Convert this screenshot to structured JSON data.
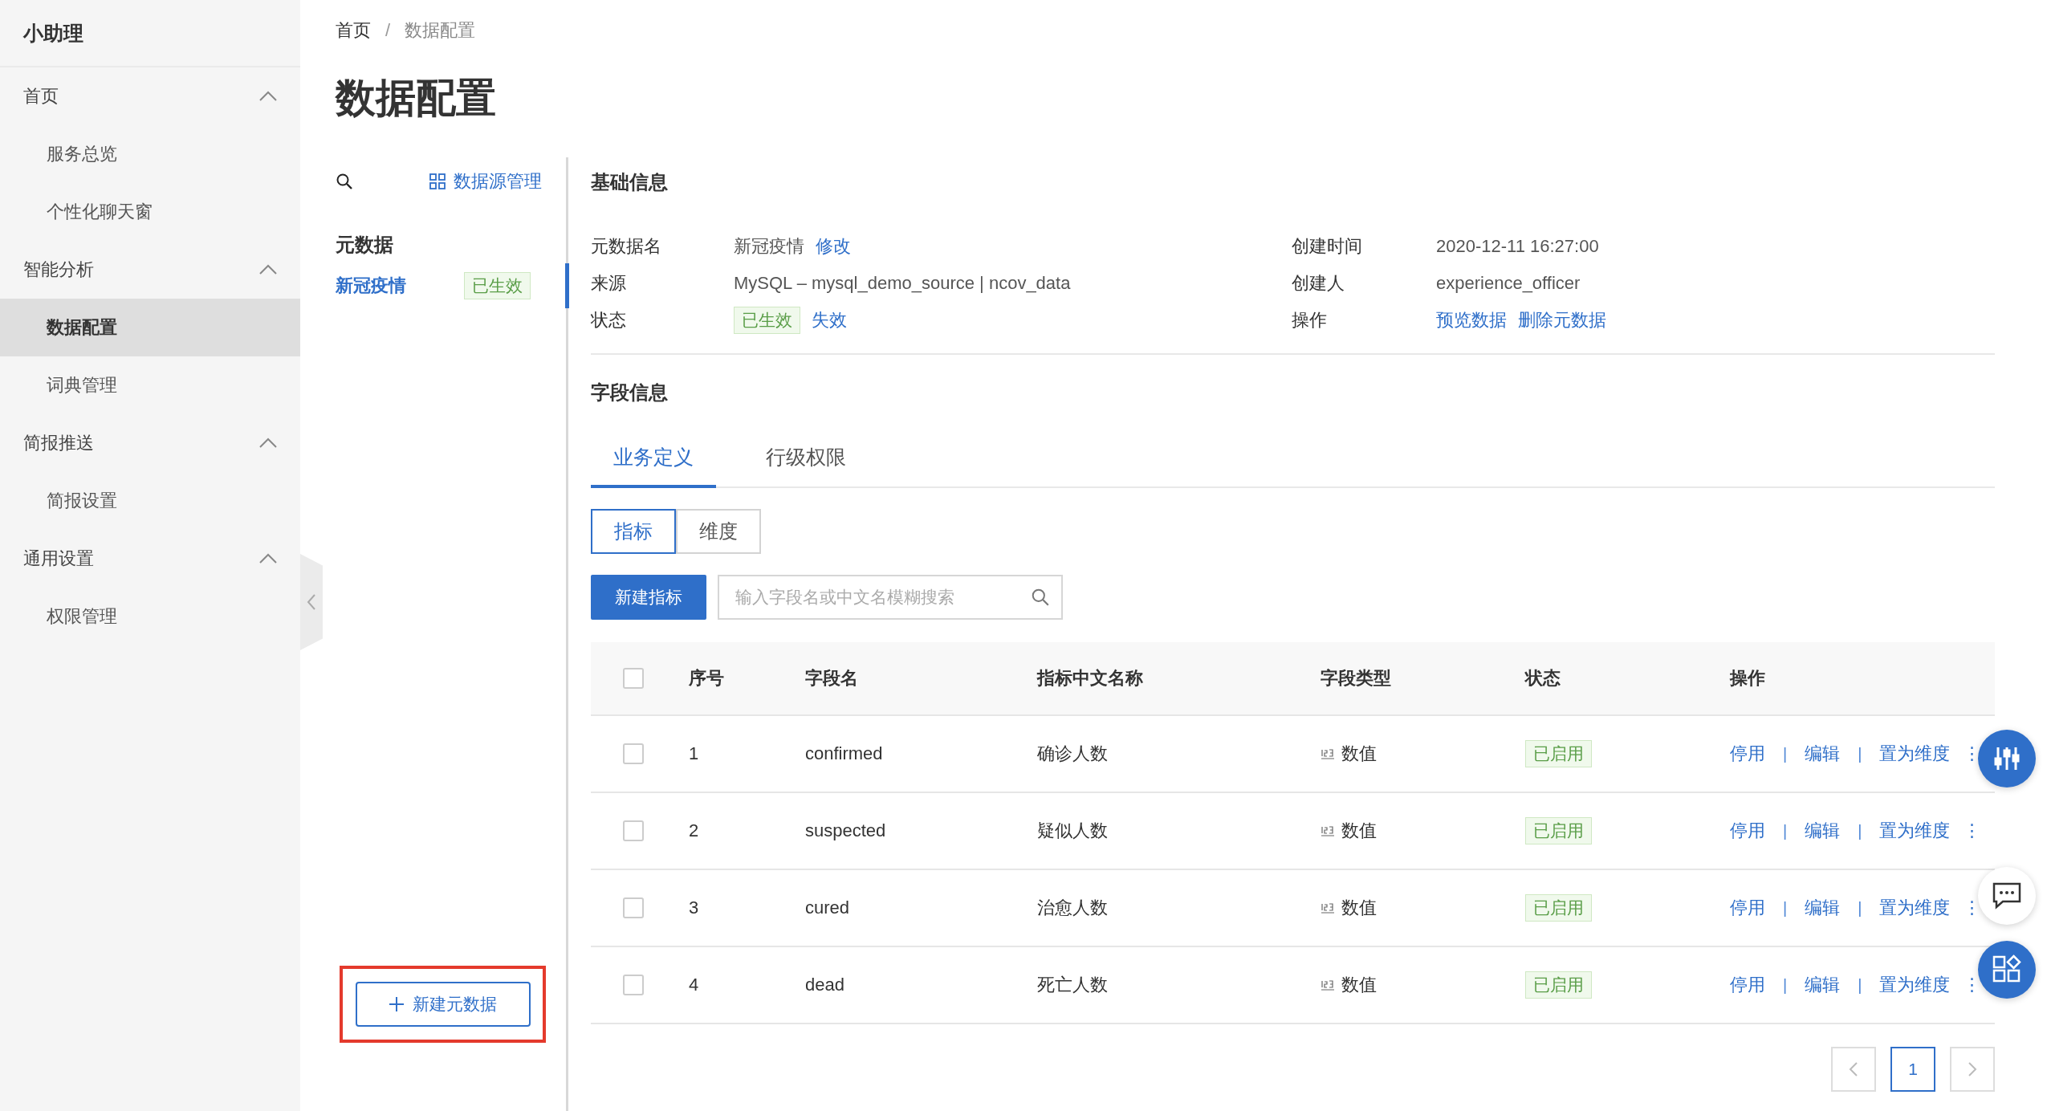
{
  "sidebar": {
    "brand": "小助理",
    "groups": [
      {
        "label": "首页",
        "expanded": true,
        "children": [
          {
            "label": "服务总览",
            "selected": false
          },
          {
            "label": "个性化聊天窗",
            "selected": false
          }
        ]
      },
      {
        "label": "智能分析",
        "expanded": true,
        "children": [
          {
            "label": "数据配置",
            "selected": true
          },
          {
            "label": "词典管理",
            "selected": false
          }
        ]
      },
      {
        "label": "简报推送",
        "expanded": true,
        "children": [
          {
            "label": "简报设置",
            "selected": false
          }
        ]
      },
      {
        "label": "通用设置",
        "expanded": true,
        "children": [
          {
            "label": "权限管理",
            "selected": false
          }
        ]
      }
    ]
  },
  "breadcrumb": [
    {
      "kind": "link",
      "label": "首页"
    },
    {
      "kind": "separator",
      "label": "/"
    },
    {
      "kind": "current",
      "label": "数据配置"
    }
  ],
  "page_title": "数据配置",
  "meta_list": {
    "source_link": "数据源管理",
    "section_title": "元数据",
    "items": [
      {
        "name": "新冠疫情",
        "status": "已生效",
        "selected": true
      }
    ],
    "new_button": {
      "label": "新建元数据",
      "highlighted": true
    }
  },
  "basic_info": {
    "title": "基础信息",
    "left": [
      {
        "label": "元数据名",
        "value": "新冠疫情",
        "links": [
          "修改"
        ]
      },
      {
        "label": "来源",
        "value": "MySQL – mysql_demo_source | ncov_data"
      },
      {
        "label": "状态",
        "tag": "已生效",
        "links": [
          "失效"
        ]
      }
    ],
    "right": [
      {
        "label": "创建时间",
        "value": "2020-12-11 16:27:00"
      },
      {
        "label": "创建人",
        "value": "experience_officer"
      },
      {
        "label": "操作",
        "links": [
          "预览数据",
          "删除元数据"
        ]
      }
    ]
  },
  "field_info": {
    "title": "字段信息",
    "tabs": [
      {
        "label": "业务定义",
        "selected": true
      },
      {
        "label": "行级权限",
        "selected": false
      }
    ],
    "segments": [
      {
        "label": "指标",
        "selected": true
      },
      {
        "label": "维度",
        "selected": false
      }
    ],
    "new_button": "新建指标",
    "search": {
      "placeholder": "输入字段名或中文名模糊搜索"
    },
    "table": {
      "columns": [
        "序号",
        "字段名",
        "指标中文名称",
        "字段类型",
        "状态",
        "操作"
      ],
      "all_checked": false,
      "rows": [
        {
          "checked": false,
          "index": "1",
          "field": "confirmed",
          "name": "确诊人数",
          "type": "数值",
          "status": "已启用",
          "actions": [
            {
              "kind": "link",
              "label": "停用"
            },
            {
              "kind": "separator",
              "label": "|"
            },
            {
              "kind": "link",
              "label": "编辑"
            },
            {
              "kind": "separator",
              "label": "|"
            },
            {
              "kind": "link",
              "label": "置为维度"
            }
          ],
          "more": "⋮"
        },
        {
          "checked": false,
          "index": "2",
          "field": "suspected",
          "name": "疑似人数",
          "type": "数值",
          "status": "已启用",
          "actions": [
            {
              "kind": "link",
              "label": "停用"
            },
            {
              "kind": "separator",
              "label": "|"
            },
            {
              "kind": "link",
              "label": "编辑"
            },
            {
              "kind": "separator",
              "label": "|"
            },
            {
              "kind": "link",
              "label": "置为维度"
            }
          ],
          "more": "⋮"
        },
        {
          "checked": false,
          "index": "3",
          "field": "cured",
          "name": "治愈人数",
          "type": "数值",
          "status": "已启用",
          "actions": [
            {
              "kind": "link",
              "label": "停用"
            },
            {
              "kind": "separator",
              "label": "|"
            },
            {
              "kind": "link",
              "label": "编辑"
            },
            {
              "kind": "separator",
              "label": "|"
            },
            {
              "kind": "link",
              "label": "置为维度"
            }
          ],
          "more": "⋮"
        },
        {
          "checked": false,
          "index": "4",
          "field": "dead",
          "name": "死亡人数",
          "type": "数值",
          "status": "已启用",
          "actions": [
            {
              "kind": "link",
              "label": "停用"
            },
            {
              "kind": "separator",
              "label": "|"
            },
            {
              "kind": "link",
              "label": "编辑"
            },
            {
              "kind": "separator",
              "label": "|"
            },
            {
              "kind": "link",
              "label": "置为维度"
            }
          ],
          "more": "⋮"
        }
      ]
    },
    "pagination": {
      "pages": [
        {
          "label": "1",
          "selected": true
        }
      ]
    }
  }
}
